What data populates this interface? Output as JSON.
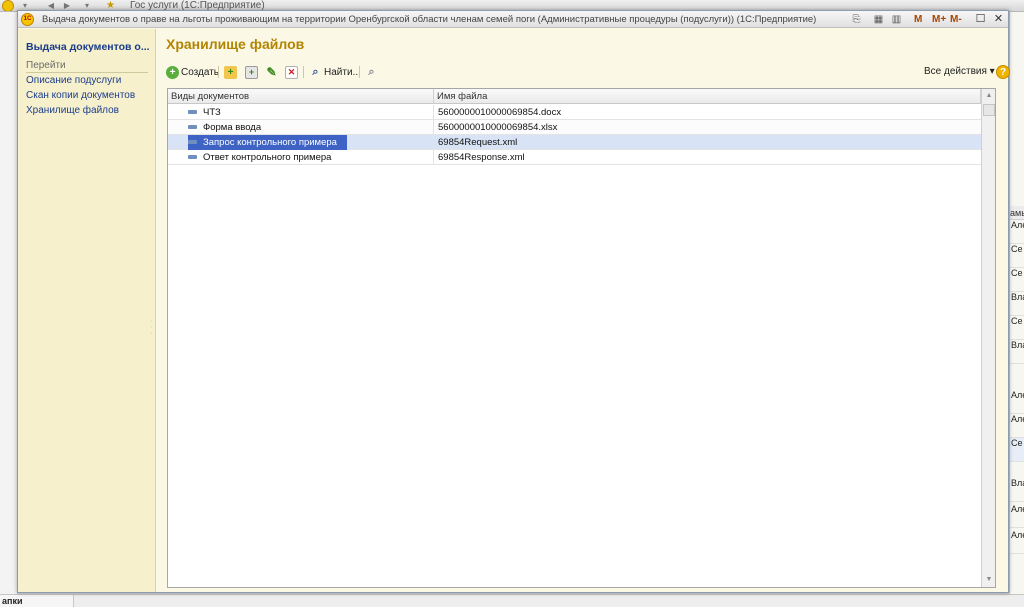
{
  "background": {
    "app_title": "Гос услуги  (1С:Предприятие)",
    "bottom_tab": "апки",
    "right_header": "амы",
    "right_rows": [
      "Але",
      "Се ров",
      "Се ров",
      "Вла",
      "Се ров",
      "Вла",
      "Але",
      "Але",
      "Се ров",
      "Вла",
      "Але",
      "Але"
    ]
  },
  "window": {
    "title": "Выдача документов о праве на льготы проживающим на территории Оренбургской области членам семей поги (Административные процедуры (подуслуги))  (1С:Предприятие)",
    "memory_buttons": [
      "M",
      "M+",
      "M-"
    ]
  },
  "sidebar": {
    "title": "Выдача документов о...",
    "section": "Перейти",
    "links": [
      "Описание подуслуги",
      "Скан копии документов",
      "Хранилище файлов"
    ]
  },
  "content": {
    "page_title": "Хранилище файлов",
    "toolbar": {
      "create_label": "Создать",
      "find_label": "Найти...",
      "all_actions_label": "Все действия ▾",
      "help_label": "?"
    },
    "table": {
      "columns": [
        "Виды документов",
        "Имя файла"
      ],
      "rows": [
        {
          "type": "ЧТЗ",
          "file": "5600000010000069854.docx"
        },
        {
          "type": "Форма ввода",
          "file": "5600000010000069854.xlsx"
        },
        {
          "type": "Запрос контрольного примера",
          "file": "69854Request.xml"
        },
        {
          "type": "Ответ контрольного примера",
          "file": "69854Response.xml"
        }
      ],
      "selected_row": 2
    }
  }
}
